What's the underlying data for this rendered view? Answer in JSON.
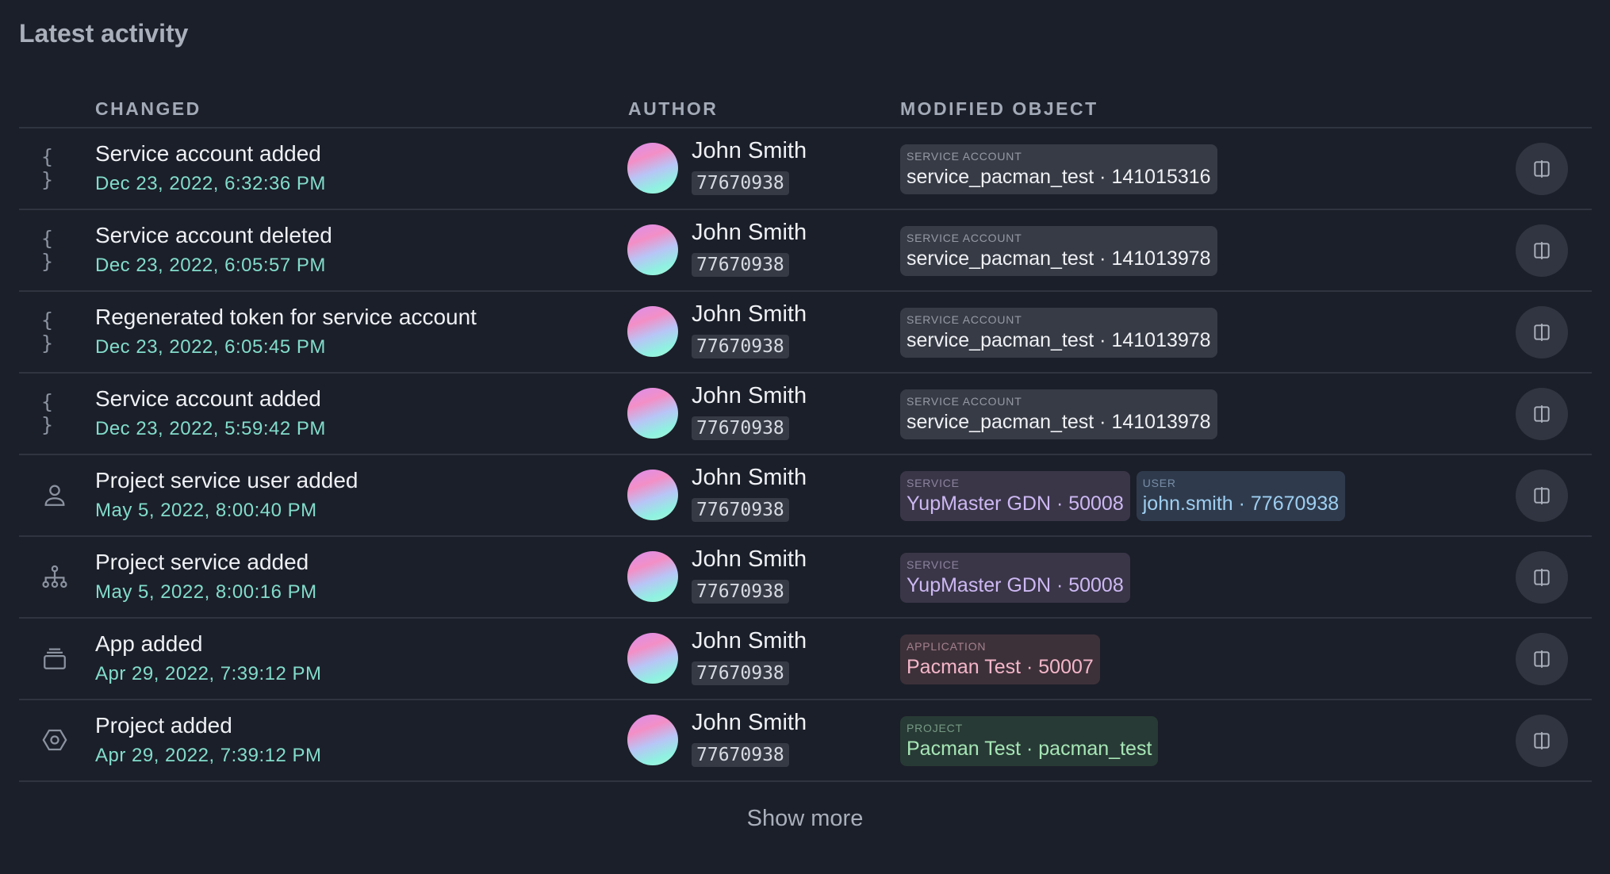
{
  "section_title": "Latest activity",
  "columns": {
    "changed": "CHANGED",
    "author": "AUTHOR",
    "modified_object": "MODIFIED OBJECT"
  },
  "rows": [
    {
      "icon": "braces-icon",
      "title": "Service account added",
      "time": "Dec 23, 2022, 6:32:36 PM",
      "author_name": "John Smith",
      "author_id": "77670938",
      "objects": [
        {
          "kind": "service-account",
          "label": "SERVICE ACCOUNT",
          "value": "service_pacman_test · 141015316"
        }
      ]
    },
    {
      "icon": "braces-icon",
      "title": "Service account deleted",
      "time": "Dec 23, 2022, 6:05:57 PM",
      "author_name": "John Smith",
      "author_id": "77670938",
      "objects": [
        {
          "kind": "service-account",
          "label": "SERVICE ACCOUNT",
          "value": "service_pacman_test · 141013978"
        }
      ]
    },
    {
      "icon": "braces-icon",
      "title": "Regenerated token for service account",
      "time": "Dec 23, 2022, 6:05:45 PM",
      "author_name": "John Smith",
      "author_id": "77670938",
      "objects": [
        {
          "kind": "service-account",
          "label": "SERVICE ACCOUNT",
          "value": "service_pacman_test · 141013978"
        }
      ]
    },
    {
      "icon": "braces-icon",
      "title": "Service account added",
      "time": "Dec 23, 2022, 5:59:42 PM",
      "author_name": "John Smith",
      "author_id": "77670938",
      "objects": [
        {
          "kind": "service-account",
          "label": "SERVICE ACCOUNT",
          "value": "service_pacman_test · 141013978"
        }
      ]
    },
    {
      "icon": "person-icon",
      "title": "Project service user added",
      "time": "May 5, 2022, 8:00:40 PM",
      "author_name": "John Smith",
      "author_id": "77670938",
      "objects": [
        {
          "kind": "service",
          "label": "SERVICE",
          "value": "YupMaster GDN · 50008"
        },
        {
          "kind": "user",
          "label": "USER",
          "value": "john.smith · 77670938"
        }
      ]
    },
    {
      "icon": "hierarchy-icon",
      "title": "Project service added",
      "time": "May 5, 2022, 8:00:16 PM",
      "author_name": "John Smith",
      "author_id": "77670938",
      "objects": [
        {
          "kind": "service",
          "label": "SERVICE",
          "value": "YupMaster GDN · 50008"
        }
      ]
    },
    {
      "icon": "stack-icon",
      "title": "App added",
      "time": "Apr 29, 2022, 7:39:12 PM",
      "author_name": "John Smith",
      "author_id": "77670938",
      "objects": [
        {
          "kind": "application",
          "label": "APPLICATION",
          "value": "Pacman Test · 50007"
        }
      ]
    },
    {
      "icon": "hexagon-icon",
      "title": "Project added",
      "time": "Apr 29, 2022, 7:39:12 PM",
      "author_name": "John Smith",
      "author_id": "77670938",
      "objects": [
        {
          "kind": "project",
          "label": "PROJECT",
          "value": "Pacman Test · pacman_test"
        }
      ]
    }
  ],
  "show_more_label": "Show more",
  "colors": {
    "background": "#1b1f29",
    "timestamp": "#82dccb",
    "service_account_tag": "#373b45",
    "service_tag": "#3a3648",
    "user_tag": "#2f3b4d",
    "application_tag": "#3d3139",
    "project_tag": "#283a35"
  }
}
